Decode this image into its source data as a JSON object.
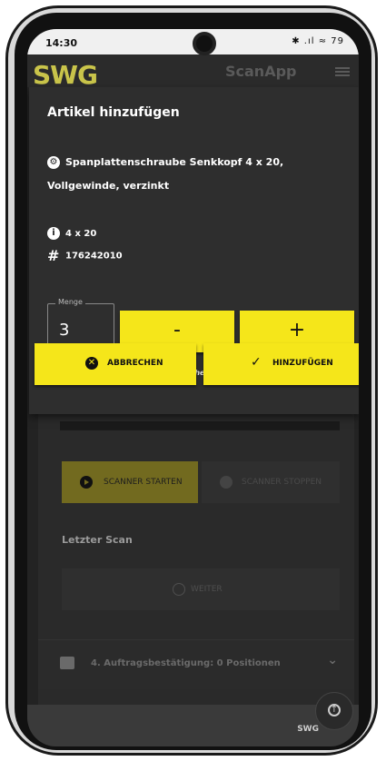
{
  "status": {
    "time": "14:30",
    "icons": "✱ .ıl ≈ 79"
  },
  "app": {
    "logo": "SWG",
    "name": "ScanApp"
  },
  "dialog": {
    "title": "Artikel hinzufügen",
    "article_name": "Spanplattenschraube Senkkopf 4 x 20, Vollgewinde, verzinkt",
    "size": "4 x 20",
    "article_number": "176242010",
    "qty_label": "Menge",
    "qty_value": "3",
    "minus_label": "-",
    "plus_label": "+",
    "hint": "(Mindestmenge: 1 | Verpackungseinheit: 1)",
    "cancel_label": "ABBRECHEN",
    "add_label": "HINZUFÜGEN"
  },
  "scanner": {
    "start_label": "SCANNER STARTEN",
    "stop_label": "SCANNER STOPPEN",
    "last_scan_label": "Letzter Scan",
    "next_label": "WEITER"
  },
  "section": {
    "label": "4. Auftragsbestätigung: 0 Positionen"
  },
  "footer": {
    "text": "SWG"
  },
  "colors": {
    "accent": "#f5e61a",
    "background": "#232323",
    "dialog": "#2e2e2e"
  }
}
